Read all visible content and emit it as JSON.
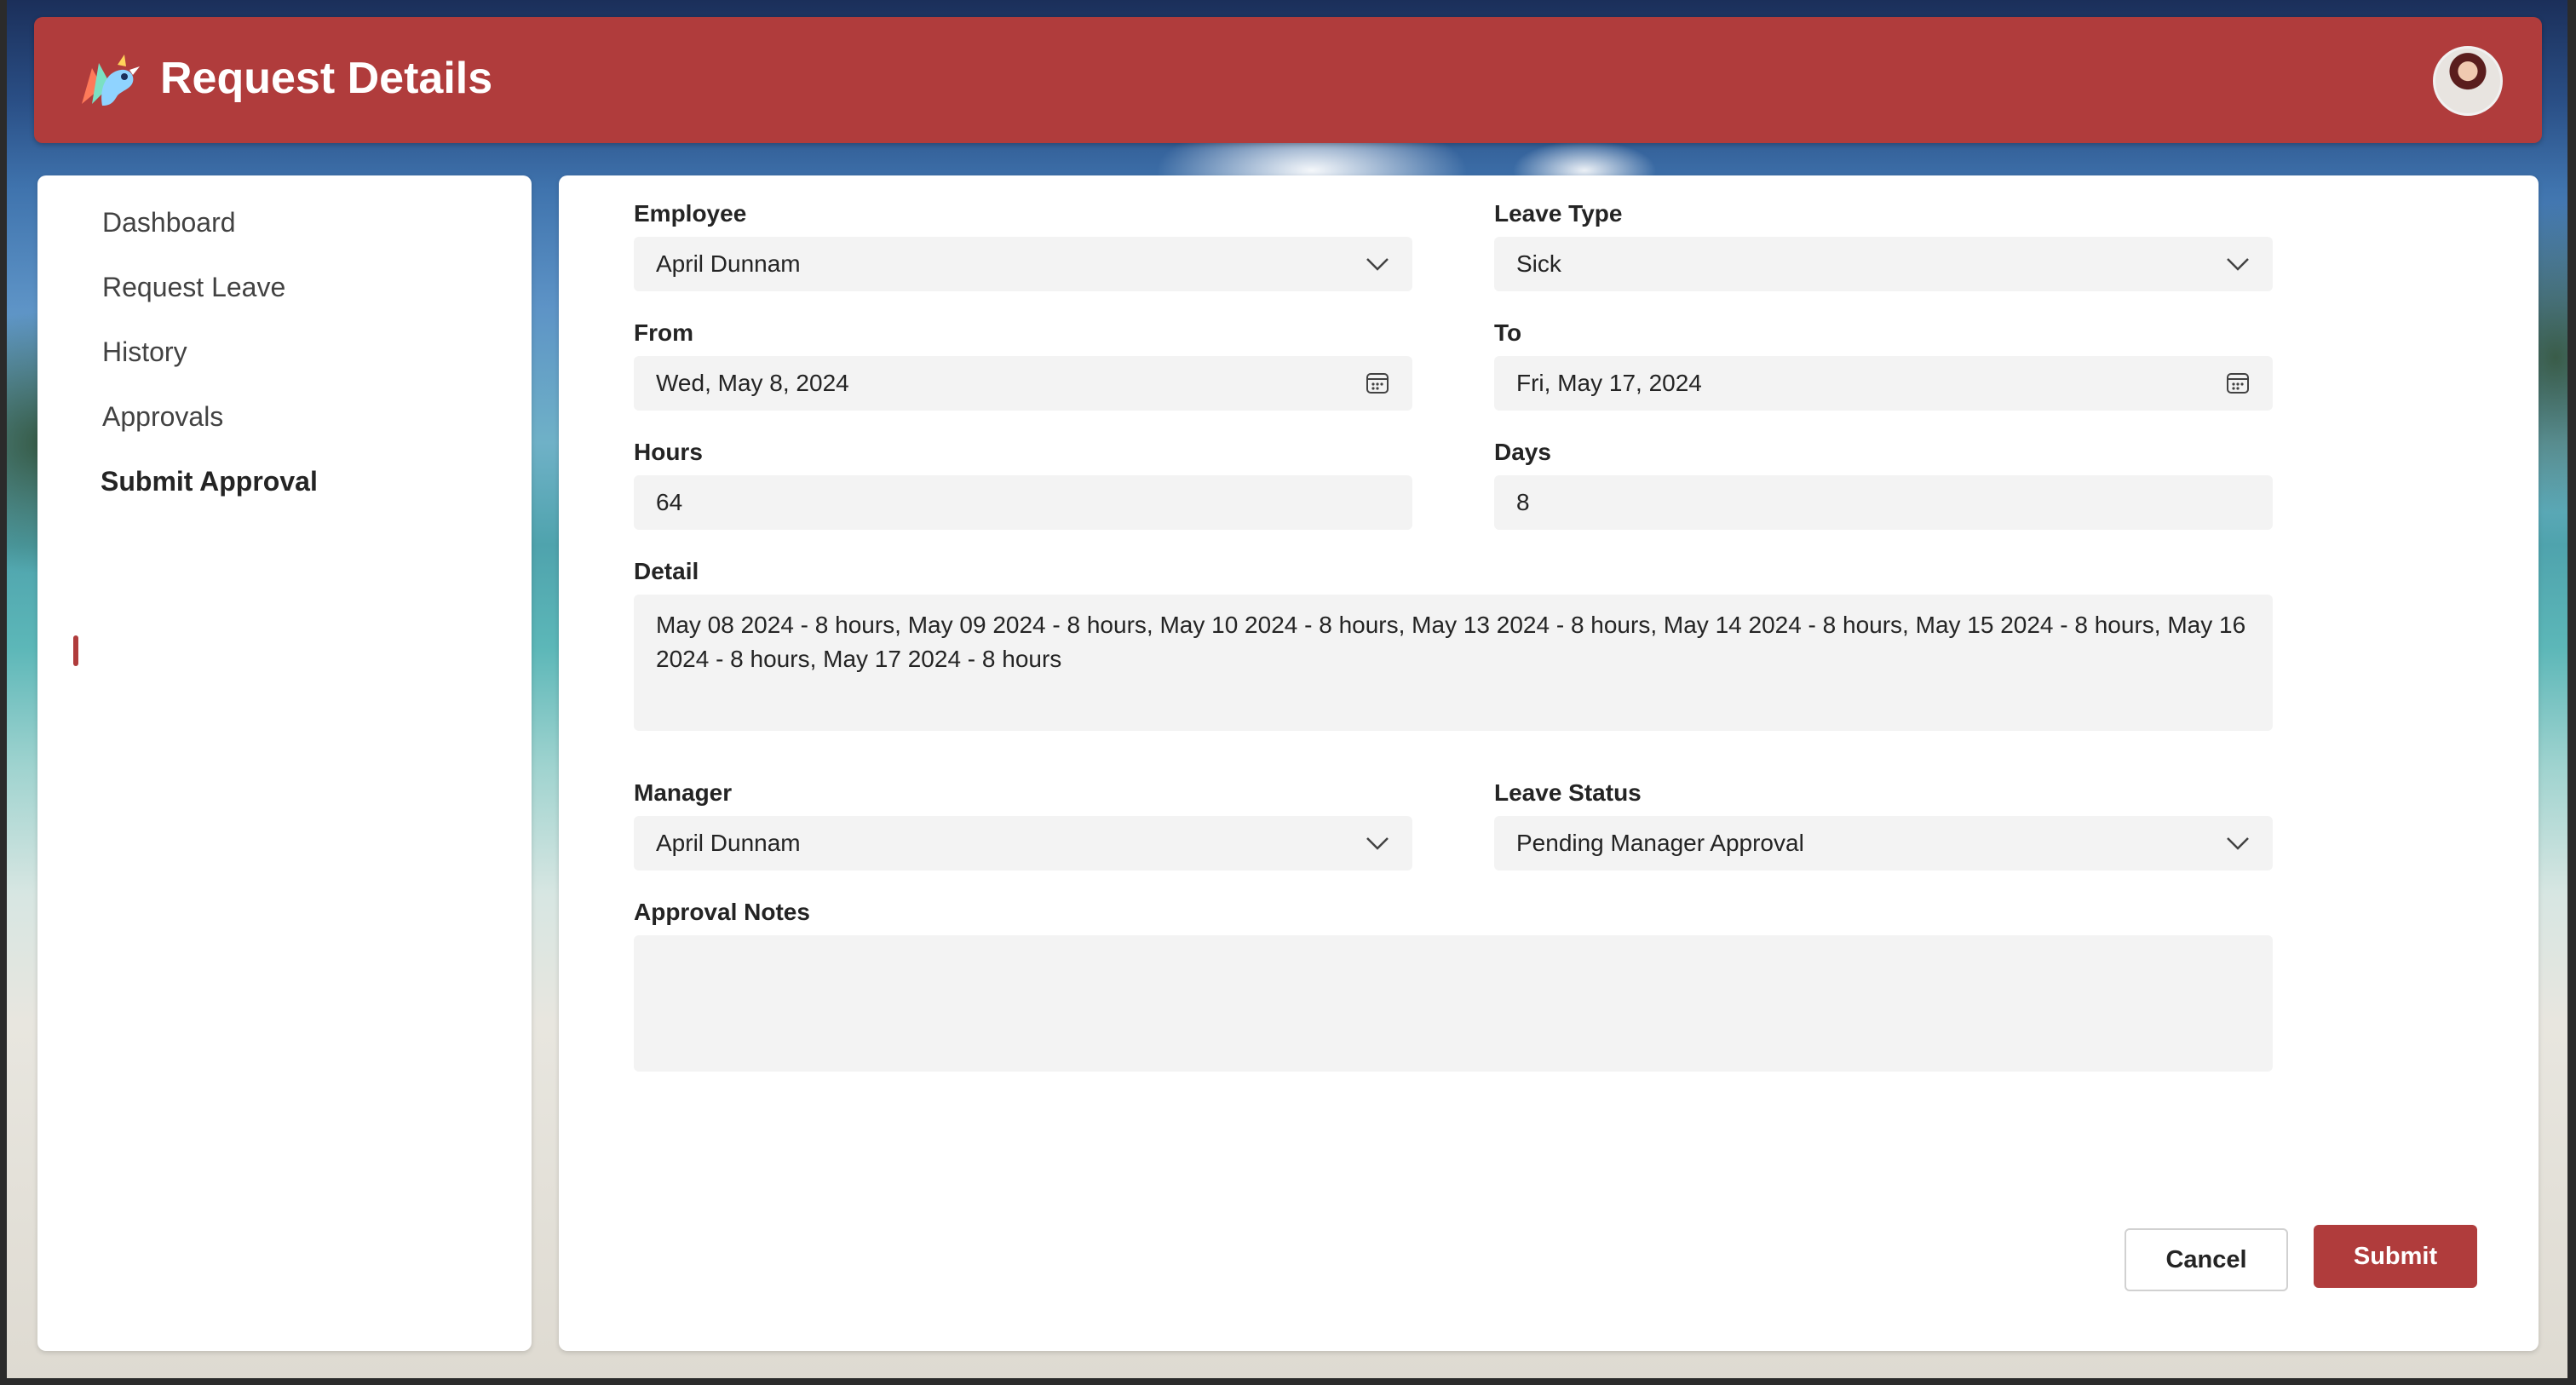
{
  "header": {
    "title": "Request Details",
    "logo_icon": "app-logo-icon",
    "avatar_icon": "user-avatar"
  },
  "sidebar": {
    "items": [
      {
        "label": "Dashboard",
        "active": false
      },
      {
        "label": "Request Leave",
        "active": false
      },
      {
        "label": "History",
        "active": false
      },
      {
        "label": "Approvals",
        "active": false
      },
      {
        "label": "Submit Approval",
        "active": true
      }
    ]
  },
  "form": {
    "employee": {
      "label": "Employee",
      "value": "April Dunnam"
    },
    "leave_type": {
      "label": "Leave Type",
      "value": "Sick"
    },
    "from": {
      "label": "From",
      "value": "Wed, May 8, 2024"
    },
    "to": {
      "label": "To",
      "value": "Fri, May 17, 2024"
    },
    "hours": {
      "label": "Hours",
      "value": "64"
    },
    "days": {
      "label": "Days",
      "value": "8"
    },
    "detail": {
      "label": "Detail",
      "value": "May 08 2024 - 8 hours, May 09 2024 - 8 hours, May 10 2024 - 8 hours, May 13 2024 - 8 hours, May 14 2024 - 8 hours, May 15 2024 - 8 hours, May 16 2024 - 8 hours, May 17 2024 - 8 hours"
    },
    "manager": {
      "label": "Manager",
      "value": "April Dunnam"
    },
    "leave_status": {
      "label": "Leave Status",
      "value": "Pending Manager Approval"
    },
    "approval_notes": {
      "label": "Approval Notes",
      "value": ""
    }
  },
  "actions": {
    "cancel_label": "Cancel",
    "submit_label": "Submit"
  },
  "colors": {
    "accent": "#b03c3c",
    "field_bg": "#f3f3f3"
  }
}
